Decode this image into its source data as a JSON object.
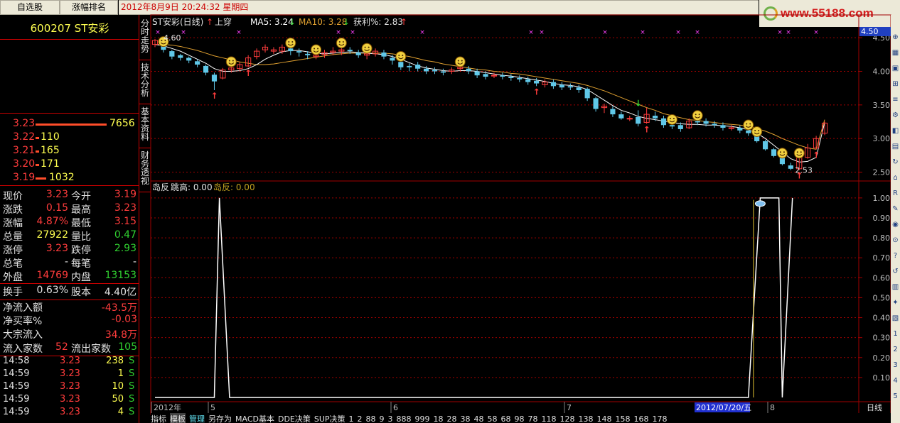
{
  "tabs": {
    "watchlist": "自选股",
    "ranking": "涨幅排名"
  },
  "datetime": "2012年8月9日  20:24:32 星期四",
  "logo": "www.55188.com",
  "stock": {
    "code_name": "600207 ST安彩"
  },
  "orderbook": [
    {
      "price": "3.23",
      "volume": "7656",
      "bar": 1.0
    },
    {
      "price": "3.22",
      "volume": "110",
      "bar": 0.0
    },
    {
      "price": "3.21",
      "volume": "165",
      "bar": 0.0
    },
    {
      "price": "3.20",
      "volume": "171",
      "bar": 0.0
    },
    {
      "price": "3.19",
      "volume": "1032",
      "bar": 0.15
    }
  ],
  "quote": [
    {
      "l1": "现价",
      "v1": "3.23",
      "c1": "red",
      "l2": "今开",
      "v2": "3.19",
      "c2": "red"
    },
    {
      "l1": "涨跌",
      "v1": "0.15",
      "c1": "red",
      "l2": "最高",
      "v2": "3.23",
      "c2": "red"
    },
    {
      "l1": "涨幅",
      "v1": "4.87%",
      "c1": "red",
      "l2": "最低",
      "v2": "3.15",
      "c2": "red"
    },
    {
      "l1": "总量",
      "v1": "27922",
      "c1": "yel",
      "l2": "量比",
      "v2": "0.47",
      "c2": "grn"
    },
    {
      "l1": "涨停",
      "v1": "3.23",
      "c1": "red",
      "l2": "跌停",
      "v2": "2.93",
      "c2": "grn"
    },
    {
      "l1": "总笔",
      "v1": "-",
      "c1": "wht",
      "l2": "每笔",
      "v2": "-",
      "c2": "wht"
    },
    {
      "l1": "外盘",
      "v1": "14769",
      "c1": "red",
      "l2": "内盘",
      "v2": "13153",
      "c2": "grn"
    }
  ],
  "turnover": {
    "label": "换手",
    "value": "0.63%",
    "label2": "股本",
    "value2": "4.40亿"
  },
  "flow": [
    {
      "label": "净流入额",
      "value": "-43.5万",
      "color": "red"
    },
    {
      "label": "净买率%",
      "value": "-0.03",
      "color": "red"
    },
    {
      "label": "大宗流入",
      "value": "34.8万",
      "color": "red"
    }
  ],
  "flow_count": {
    "label_in": "流入家数",
    "in": "52",
    "label_out": "流出家数",
    "out": "105"
  },
  "ticks": [
    {
      "time": "14:58",
      "price": "3.23",
      "vol": "238",
      "side": "S"
    },
    {
      "time": "14:59",
      "price": "3.23",
      "vol": "1",
      "side": "S"
    },
    {
      "time": "14:59",
      "price": "3.23",
      "vol": "10",
      "side": "S"
    },
    {
      "time": "14:59",
      "price": "3.23",
      "vol": "50",
      "side": "S"
    },
    {
      "time": "14:59",
      "price": "3.23",
      "vol": "4",
      "side": "S"
    }
  ],
  "vtabs": [
    "分时走势",
    "技术分析",
    "基本资料",
    "财务透视"
  ],
  "main_chart": {
    "title": "ST安彩(日线)",
    "signal": "上穿",
    "ma5_label": "MA5: 3.24",
    "ma10_label": "MA10: 3.28",
    "profit_label": "获利%: 2.83",
    "high_mark": "4.60",
    "low_mark": "2.53",
    "current_price_badge": "4.50",
    "y_ticks": [
      "4.50",
      "4.00",
      "3.50",
      "3.00",
      "2.50"
    ]
  },
  "indicator": {
    "name": "岛反",
    "param": "跳高: 0.00",
    "value_label": "岛反: 0.00",
    "y_ticks": [
      "1.00",
      "0.90",
      "0.80",
      "0.70",
      "0.60",
      "0.50",
      "0.40",
      "0.30",
      "0.20",
      "0.10"
    ]
  },
  "xaxis": {
    "labels": [
      "2012年",
      "5",
      "6",
      "7",
      "8"
    ],
    "highlight": "2012/07/20/五",
    "period": "日线"
  },
  "bottom_tabs": [
    "指标",
    "模板",
    "管理",
    "另存为",
    "MACD基本",
    "DDE决策",
    "SUP决策",
    "1",
    "2",
    "88",
    "9",
    "3",
    "888",
    "999",
    "18",
    "28",
    "38",
    "48",
    "58",
    "68",
    "98",
    "78",
    "118",
    "128",
    "138",
    "148",
    "158",
    "168",
    "178"
  ],
  "colors": {
    "up": "#ff3c3c",
    "down": "#60c8e8",
    "ma5": "#ffffff",
    "ma10": "#e0a030",
    "grid": "#a00000"
  },
  "chart_data": {
    "type": "candlestick",
    "candles": [
      [
        4.4,
        4.46,
        4.36,
        4.48
      ],
      [
        4.38,
        4.32,
        4.28,
        4.4
      ],
      [
        4.3,
        4.22,
        4.18,
        4.32
      ],
      [
        4.24,
        4.2,
        4.16,
        4.26
      ],
      [
        4.2,
        4.16,
        4.12,
        4.22
      ],
      [
        4.15,
        4.1,
        4.06,
        4.18
      ],
      [
        4.08,
        3.98,
        3.94,
        4.1
      ],
      [
        3.95,
        3.85,
        3.72,
        3.98
      ],
      [
        3.9,
        4.02,
        3.88,
        4.05
      ],
      [
        4.02,
        4.05,
        3.98,
        4.1
      ],
      [
        4.04,
        4.1,
        4.0,
        4.14
      ],
      [
        4.08,
        4.2,
        4.06,
        4.24
      ],
      [
        4.22,
        4.3,
        4.18,
        4.34
      ],
      [
        4.32,
        4.36,
        4.28,
        4.4
      ],
      [
        4.3,
        4.32,
        4.26,
        4.36
      ],
      [
        4.3,
        4.36,
        4.26,
        4.4
      ],
      [
        4.34,
        4.3,
        4.24,
        4.38
      ],
      [
        4.3,
        4.28,
        4.22,
        4.34
      ],
      [
        4.26,
        4.24,
        4.18,
        4.3
      ],
      [
        4.22,
        4.24,
        4.18,
        4.28
      ],
      [
        4.25,
        4.28,
        4.2,
        4.32
      ],
      [
        4.28,
        4.3,
        4.24,
        4.36
      ],
      [
        4.3,
        4.32,
        4.24,
        4.38
      ],
      [
        4.32,
        4.3,
        4.26,
        4.36
      ],
      [
        4.28,
        4.24,
        4.2,
        4.32
      ],
      [
        4.24,
        4.26,
        4.18,
        4.3
      ],
      [
        4.26,
        4.3,
        4.22,
        4.34
      ],
      [
        4.28,
        4.22,
        4.18,
        4.32
      ],
      [
        4.2,
        4.16,
        4.1,
        4.24
      ],
      [
        4.14,
        4.06,
        4.02,
        4.18
      ],
      [
        4.08,
        4.06,
        4.0,
        4.12
      ],
      [
        4.1,
        4.04,
        4.0,
        4.14
      ],
      [
        4.04,
        4.0,
        3.96,
        4.08
      ],
      [
        4.02,
        4.0,
        3.96,
        4.06
      ],
      [
        4.0,
        3.98,
        3.94,
        4.04
      ],
      [
        4.0,
        4.02,
        3.96,
        4.06
      ],
      [
        4.04,
        4.06,
        4.0,
        4.1
      ],
      [
        4.04,
        4.0,
        3.96,
        4.08
      ],
      [
        4.0,
        3.94,
        3.9,
        4.04
      ],
      [
        3.96,
        3.92,
        3.88,
        4.0
      ],
      [
        3.94,
        3.94,
        3.9,
        3.98
      ],
      [
        3.94,
        3.92,
        3.88,
        3.98
      ],
      [
        3.92,
        3.9,
        3.86,
        3.96
      ],
      [
        3.9,
        3.88,
        3.84,
        3.94
      ],
      [
        3.88,
        3.84,
        3.8,
        3.92
      ],
      [
        3.86,
        3.82,
        3.78,
        3.9
      ],
      [
        3.8,
        3.84,
        3.76,
        3.88
      ],
      [
        3.84,
        3.78,
        3.74,
        3.88
      ],
      [
        3.8,
        3.76,
        3.72,
        3.84
      ],
      [
        3.78,
        3.76,
        3.72,
        3.82
      ],
      [
        3.76,
        3.72,
        3.68,
        3.8
      ],
      [
        3.74,
        3.6,
        3.56,
        3.76
      ],
      [
        3.6,
        3.44,
        3.4,
        3.62
      ],
      [
        3.46,
        3.48,
        3.38,
        3.52
      ],
      [
        3.44,
        3.36,
        3.32,
        3.48
      ],
      [
        3.36,
        3.3,
        3.28,
        3.4
      ],
      [
        3.3,
        3.3,
        3.26,
        3.34
      ],
      [
        3.32,
        3.22,
        3.18,
        3.42
      ],
      [
        3.24,
        3.36,
        3.22,
        3.46
      ],
      [
        3.34,
        3.3,
        3.26,
        3.4
      ],
      [
        3.3,
        3.2,
        3.16,
        3.34
      ],
      [
        3.2,
        3.18,
        3.14,
        3.24
      ],
      [
        3.2,
        3.14,
        3.1,
        3.24
      ],
      [
        3.16,
        3.26,
        3.14,
        3.3
      ],
      [
        3.26,
        3.24,
        3.2,
        3.3
      ],
      [
        3.26,
        3.22,
        3.18,
        3.3
      ],
      [
        3.22,
        3.2,
        3.16,
        3.26
      ],
      [
        3.2,
        3.16,
        3.12,
        3.24
      ],
      [
        3.16,
        3.16,
        3.12,
        3.2
      ],
      [
        3.16,
        3.12,
        3.08,
        3.2
      ],
      [
        3.12,
        3.08,
        3.04,
        3.16
      ],
      [
        3.04,
        2.96,
        2.94,
        3.06
      ],
      [
        2.96,
        2.84,
        2.82,
        2.98
      ],
      [
        2.84,
        2.74,
        2.72,
        2.86
      ],
      [
        2.72,
        2.62,
        2.6,
        2.74
      ],
      [
        2.6,
        2.55,
        2.53,
        2.64
      ],
      [
        2.55,
        2.72,
        2.53,
        2.74
      ],
      [
        2.72,
        2.86,
        2.7,
        2.92
      ],
      [
        2.86,
        3.0,
        2.84,
        3.04
      ],
      [
        3.08,
        3.23,
        3.05,
        3.25
      ]
    ],
    "ma5": [
      4.4,
      4.38,
      4.34,
      4.3,
      4.24,
      4.18,
      4.12,
      4.04,
      4.0,
      4.0,
      4.01,
      4.04,
      4.1,
      4.18,
      4.24,
      4.29,
      4.31,
      4.31,
      4.29,
      4.27,
      4.26,
      4.27,
      4.28,
      4.29,
      4.28,
      4.27,
      4.26,
      4.25,
      4.22,
      4.18,
      4.13,
      4.08,
      4.05,
      4.03,
      4.01,
      4.0,
      4.01,
      4.01,
      4.0,
      3.98,
      3.96,
      3.94,
      3.93,
      3.91,
      3.89,
      3.87,
      3.85,
      3.82,
      3.8,
      3.79,
      3.77,
      3.73,
      3.65,
      3.57,
      3.49,
      3.42,
      3.38,
      3.33,
      3.3,
      3.28,
      3.26,
      3.24,
      3.22,
      3.21,
      3.21,
      3.2,
      3.2,
      3.19,
      3.18,
      3.16,
      3.13,
      3.08,
      3.0,
      2.9,
      2.8,
      2.7,
      2.65,
      2.66,
      2.72,
      3.24
    ],
    "ma10": [
      4.4,
      4.4,
      4.39,
      4.37,
      4.34,
      4.31,
      4.27,
      4.23,
      4.2,
      4.17,
      4.14,
      4.12,
      4.1,
      4.1,
      4.11,
      4.13,
      4.15,
      4.17,
      4.19,
      4.21,
      4.23,
      4.25,
      4.26,
      4.27,
      4.27,
      4.27,
      4.27,
      4.27,
      4.26,
      4.24,
      4.22,
      4.19,
      4.16,
      4.14,
      4.11,
      4.09,
      4.07,
      4.05,
      4.03,
      4.02,
      4.0,
      3.99,
      3.97,
      3.96,
      3.94,
      3.92,
      3.9,
      3.88,
      3.86,
      3.84,
      3.82,
      3.79,
      3.75,
      3.71,
      3.66,
      3.61,
      3.56,
      3.51,
      3.46,
      3.42,
      3.37,
      3.34,
      3.31,
      3.28,
      3.27,
      3.25,
      3.24,
      3.22,
      3.21,
      3.2,
      3.18,
      3.15,
      3.11,
      3.06,
      3.0,
      2.95,
      2.9,
      2.86,
      2.84,
      3.28
    ],
    "smiley_markers": [
      1,
      9,
      16,
      19,
      22,
      25,
      29,
      36,
      61,
      64,
      70,
      71,
      74,
      76
    ],
    "island": [
      [
        0,
        0
      ],
      [
        7,
        0
      ],
      [
        7.6,
        1
      ],
      [
        8.8,
        0
      ],
      [
        70,
        0
      ],
      [
        71.4,
        1
      ],
      [
        72,
        1
      ],
      [
        73.6,
        1
      ],
      [
        74,
        0
      ],
      [
        75.2,
        1
      ]
    ],
    "yrange_main": [
      2.4,
      4.66
    ],
    "yrange_ind": [
      0,
      1.06
    ]
  }
}
